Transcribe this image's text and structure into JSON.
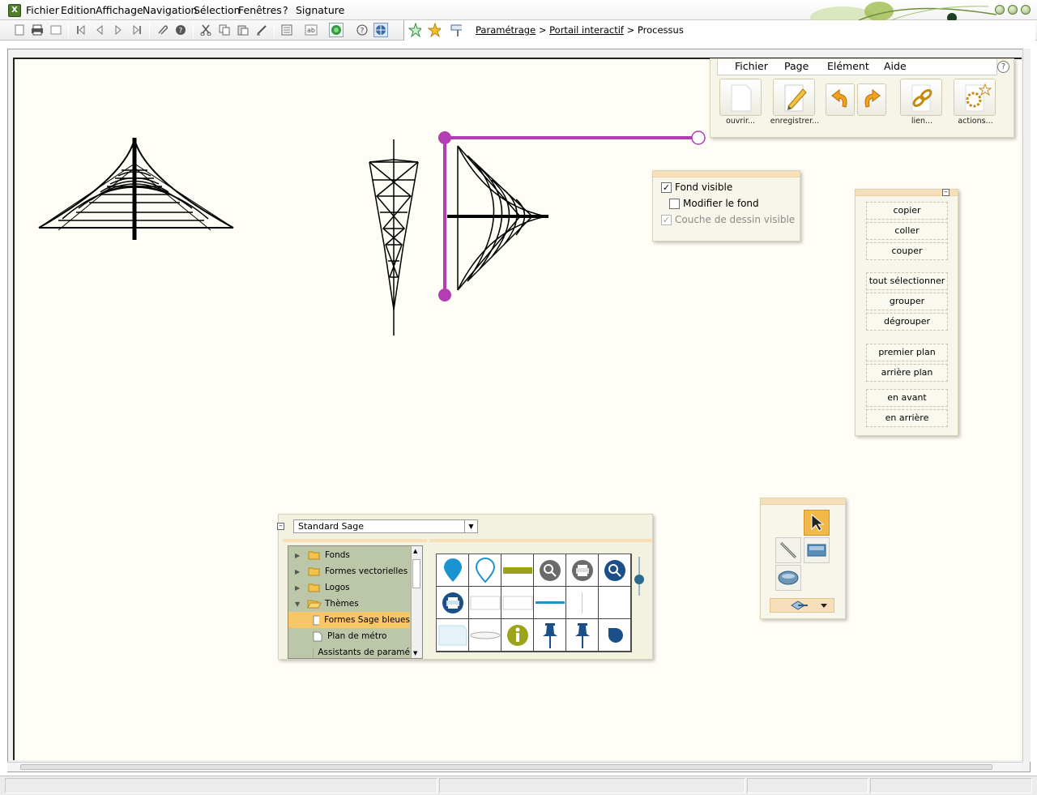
{
  "menubar": {
    "items": [
      "Fichier",
      "Edition",
      "Affichage",
      "Navigation",
      "Sélection",
      "Fenêtres",
      "?",
      "Signature"
    ]
  },
  "breadcrumb": {
    "items": [
      "Paramétrage",
      "Portail interactif",
      "Processus"
    ],
    "separator": ">"
  },
  "editor": {
    "menu": [
      "Fichier",
      "Page",
      "Elément",
      "Aide"
    ],
    "help": "?",
    "buttons": [
      "ouvrir...",
      "enregistrer...",
      "lien...",
      "actions..."
    ]
  },
  "fond": {
    "fond_visible": "Fond visible",
    "modifier_fond": "Modifier le fond",
    "couche_dessin": "Couche de dessin visible"
  },
  "actions": {
    "copier": "copier",
    "coller": "coller",
    "couper": "couper",
    "tout_selectionner": "tout sélectionner",
    "grouper": "grouper",
    "degrouper": "dégrouper",
    "premier_plan": "premier plan",
    "arriere_plan": "arrière plan",
    "en_avant": "en avant",
    "en_arriere": "en arrière"
  },
  "library": {
    "selected_set": "Standard Sage",
    "tree": [
      "Fonds",
      "Formes vectorielles",
      "Logos",
      "Thèmes",
      "Formes Sage bleues",
      "Plan de métro",
      "Assistants de paramé"
    ]
  },
  "colors": {
    "accent_magenta": "#b43cb4",
    "panel_header": "#f7e0b9",
    "selection_orange": "#f7c667",
    "canvas_bg": "#fefef6",
    "sage_blue": "#1565a8"
  }
}
